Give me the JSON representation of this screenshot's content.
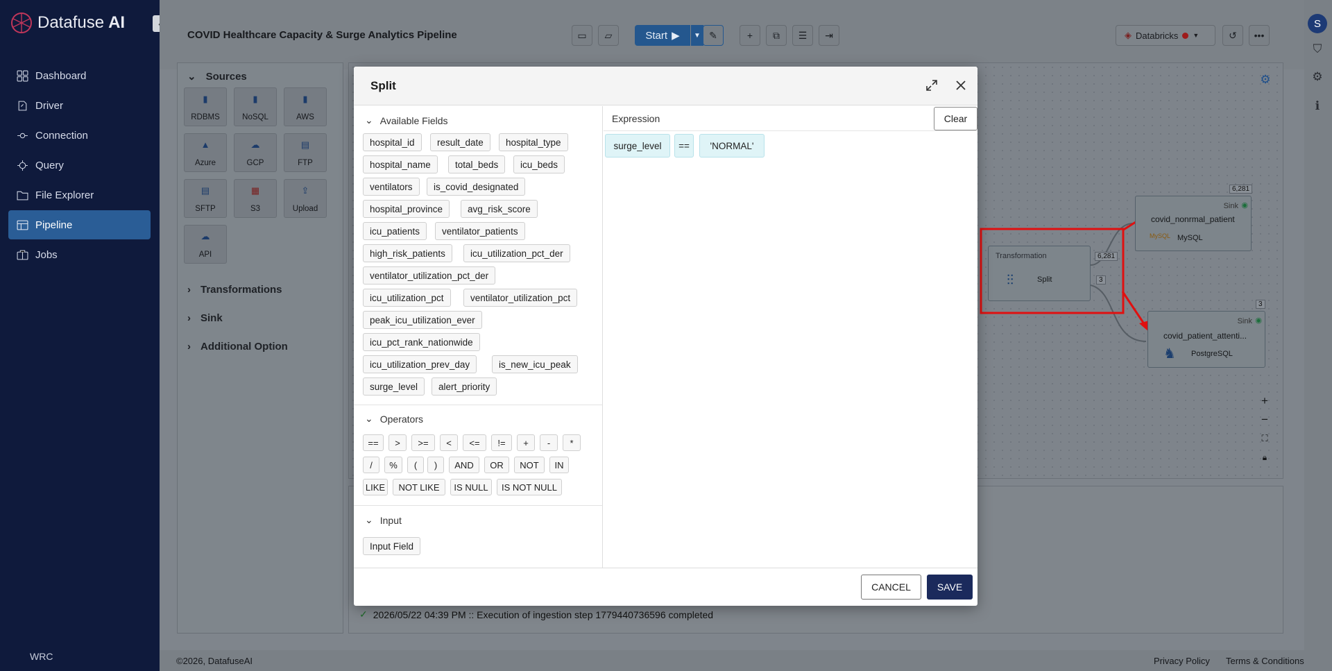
{
  "app": {
    "brand_prefix": "Datafuse",
    "brand_suffix": "AI",
    "collapse_icon": "«",
    "workspace": "WRC"
  },
  "sidebar": {
    "items": [
      {
        "label": "Dashboard",
        "icon": "grid-icon"
      },
      {
        "label": "Driver",
        "icon": "driver-icon"
      },
      {
        "label": "Connection",
        "icon": "connection-icon"
      },
      {
        "label": "Query",
        "icon": "query-icon"
      },
      {
        "label": "File Explorer",
        "icon": "folder-icon"
      },
      {
        "label": "Pipeline",
        "icon": "pipeline-icon",
        "active": true
      },
      {
        "label": "Jobs",
        "icon": "jobs-icon"
      }
    ]
  },
  "header": {
    "pipeline_title": "COVID Healthcare Capacity & Surge Analytics Pipeline",
    "start_label": "Start",
    "engine_label": "Databricks",
    "engine_status_color": "#9e1b1b",
    "user_initial": "S"
  },
  "sources": {
    "title": "Sources",
    "tiles": [
      "RDBMS",
      "NoSQL",
      "AWS",
      "Azure",
      "GCP",
      "FTP",
      "SFTP",
      "S3",
      "Upload",
      "API"
    ]
  },
  "sections": {
    "transformations": "Transformations",
    "sink": "Sink",
    "additional": "Additional Option"
  },
  "canvas": {
    "nodes": {
      "transformation": {
        "type": "Transformation",
        "name": "Split",
        "out1": "6,281",
        "out2": "3"
      },
      "sink1": {
        "type": "Sink",
        "name": "covid_nonrmal_patient",
        "db": "MySQL",
        "count": "6,281"
      },
      "sink2": {
        "type": "Sink",
        "name": "covid_patient_attenti...",
        "db": "PostgreSQL",
        "count": "3"
      }
    },
    "zoom_in": "+",
    "zoom_out": "−"
  },
  "log": {
    "text": "2026/05/22 04:39 PM :: Execution of ingestion step 1779440736596 completed",
    "status_color": "#2e7d32"
  },
  "footer": {
    "copyright": "©2026, DatafuseAI",
    "privacy": "Privacy Policy",
    "terms": "Terms & Conditions"
  },
  "modal": {
    "title": "Split",
    "available_fields_label": "Available Fields",
    "fields": [
      "hospital_id",
      "result_date",
      "hospital_type",
      "hospital_name",
      "total_beds",
      "icu_beds",
      "ventilators",
      "is_covid_designated",
      "hospital_province",
      "avg_risk_score",
      "icu_patients",
      "ventilator_patients",
      "high_risk_patients",
      "icu_utilization_pct_der",
      "ventilator_utilization_pct_der",
      "icu_utilization_pct",
      "ventilator_utilization_pct",
      "peak_icu_utilization_ever",
      "icu_pct_rank_nationwide",
      "icu_utilization_prev_day",
      "is_new_icu_peak",
      "surge_level",
      "alert_priority"
    ],
    "operators_label": "Operators",
    "operators": [
      "==",
      ">",
      ">=",
      "<",
      "<=",
      "!=",
      "+",
      "-",
      "*",
      "/",
      "%",
      "(",
      ")",
      "AND",
      "OR",
      "NOT",
      "IN",
      "LIKE",
      "NOT LIKE",
      "IS NULL",
      "IS NOT NULL"
    ],
    "input_label": "Input",
    "input_field_label": "Input Field",
    "expression_label": "Expression",
    "clear_label": "Clear",
    "expression_tokens": [
      "surge_level",
      "==",
      "'NORMAL'"
    ],
    "cancel_label": "CANCEL",
    "save_label": "SAVE"
  }
}
